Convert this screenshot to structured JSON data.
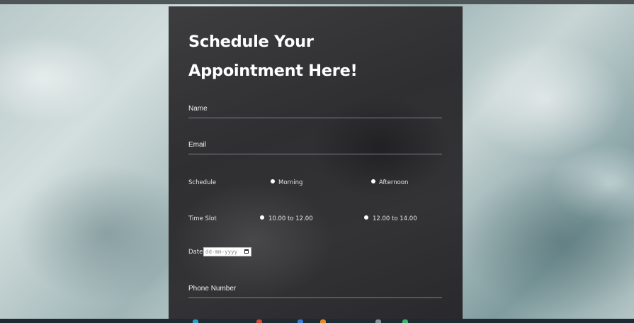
{
  "form": {
    "title": "Schedule Your Appointment Here!",
    "name_label": "Name",
    "email_label": "Email",
    "schedule": {
      "label": "Schedule",
      "options": [
        "Morning",
        "Afternoon"
      ]
    },
    "time_slot": {
      "label": "Time Slot",
      "options": [
        "10.00 to 12.00",
        "12.00 to 14.00"
      ]
    },
    "date": {
      "label": "Date",
      "placeholder": "dd-mm-yyyy"
    },
    "phone_label": "Phone Number"
  },
  "colors": {
    "card_background": "#333335",
    "underline": "#7d8189",
    "text": "#ffffff"
  },
  "icons": {
    "date_picker": "calendar-icon"
  }
}
